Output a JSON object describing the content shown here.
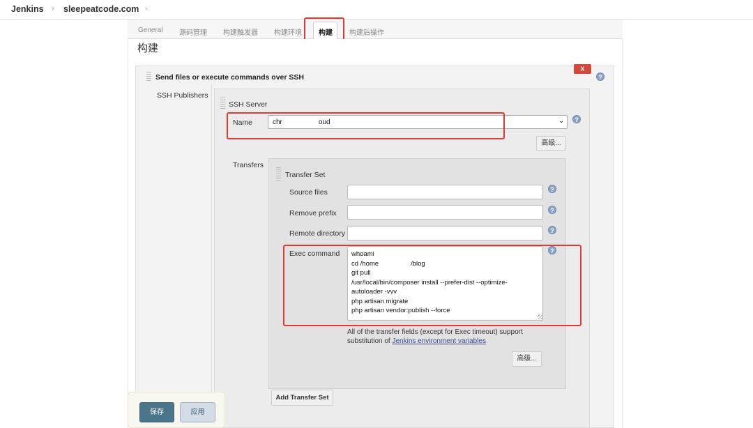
{
  "breadcrumb": {
    "home": "Jenkins",
    "project": "sleepeatcode.com"
  },
  "tabs": [
    {
      "label": "General"
    },
    {
      "label": "源码管理"
    },
    {
      "label": "构建触发器"
    },
    {
      "label": "构建环境"
    },
    {
      "label": "构建"
    },
    {
      "label": "构建后操作"
    }
  ],
  "section_title": "构建",
  "ssh_step": {
    "title": "Send files or execute commands over SSH",
    "delete_label": "X",
    "publishers_label": "SSH Publishers",
    "server_label": "SSH Server",
    "name_label": "Name",
    "name_value_start": "chr",
    "name_value_end": "oud",
    "advanced_label": "高级...",
    "transfers_label": "Transfers"
  },
  "transfer_set": {
    "title": "Transfer Set",
    "source_files_label": "Source files",
    "source_files_value": "",
    "remove_prefix_label": "Remove prefix",
    "remove_prefix_value": "",
    "remote_directory_label": "Remote directory",
    "remote_directory_value": "",
    "exec_command_label": "Exec command",
    "exec_lines": [
      "whoami",
      "cd /home",
      "/blog",
      "git pull",
      "/usr/local/bin/composer install --prefer-dist --optimize-",
      "autoloader -vvv",
      "php artisan migrate",
      "php artisan vendor:publish --force"
    ],
    "note_text": "All of the transfer fields (except for Exec timeout) support substitution of ",
    "note_link": "Jenkins environment variables",
    "advanced_label": "高级..."
  },
  "add_transfer_set_label": "Add Transfer Set",
  "help_glyph": "?",
  "footer": {
    "save_label": "保存",
    "apply_label": "应用"
  },
  "colors": {
    "highlight_border": "#e23a2e",
    "save_bg": "#4b758b",
    "delete_bg": "#d24939"
  }
}
